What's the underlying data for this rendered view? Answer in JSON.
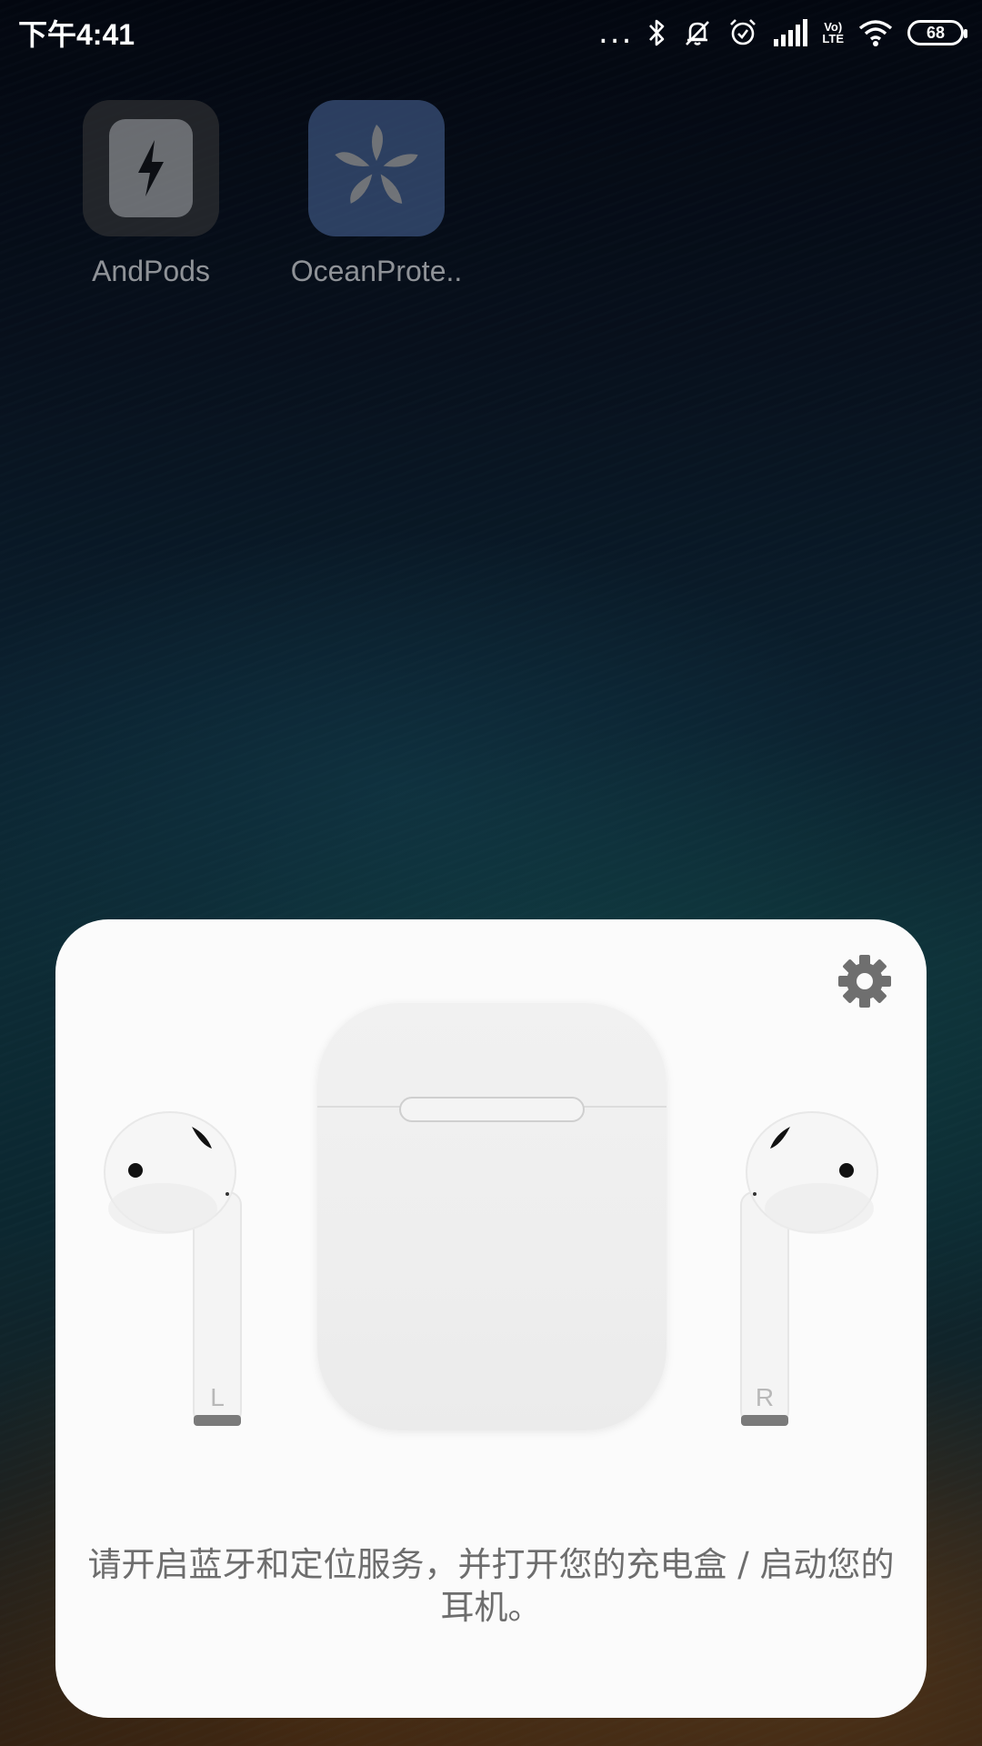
{
  "status_bar": {
    "time": "下午4:41",
    "dots": "...",
    "battery_level": "68",
    "volte_top": "Vo)",
    "volte_bottom": "LTE",
    "icons": [
      "bluetooth-icon",
      "mute-icon",
      "alarm-icon",
      "signal-icon",
      "volte-icon",
      "wifi-icon",
      "battery-icon"
    ]
  },
  "launcher": {
    "apps": [
      {
        "label": "AndPods",
        "icon": "lightning-icon",
        "color": "#bdbdbd"
      },
      {
        "label": "OceanProte..",
        "icon": "pinwheel-icon",
        "color": "#4c6a9e"
      }
    ]
  },
  "popup": {
    "settings_icon": "gear-icon",
    "left_pod_letter": "L",
    "right_pod_letter": "R",
    "message": "请开启蓝牙和定位服务，并打开您的充电盒 / 启动您的耳机。",
    "case_color": "#f0f0f0",
    "card_color": "#fbfbfb"
  }
}
